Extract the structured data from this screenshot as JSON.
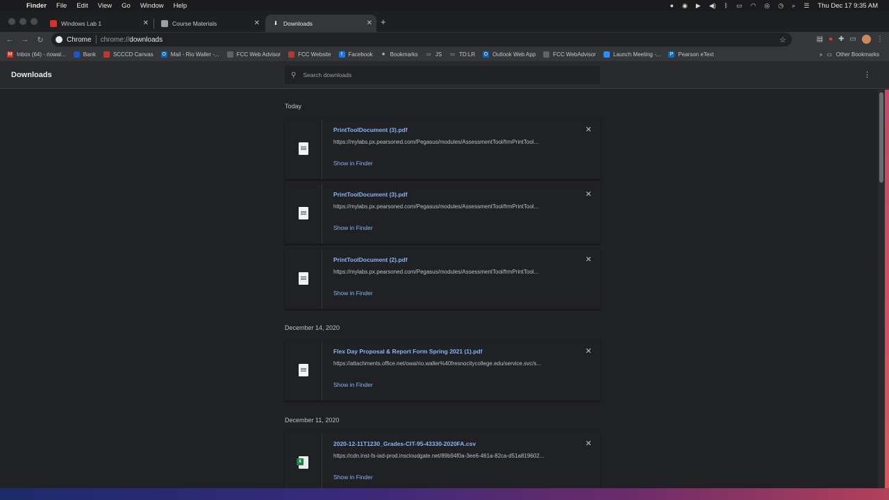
{
  "menubar": {
    "app": "Finder",
    "items": [
      "File",
      "Edit",
      "View",
      "Go",
      "Window",
      "Help"
    ],
    "clock": "Thu Dec 17  9:35 AM"
  },
  "tabs": [
    {
      "title": "Windows Lab 1",
      "icon_color": "#d93025"
    },
    {
      "title": "Course Materials",
      "icon_color": "#9aa0a6"
    },
    {
      "title": "Downloads",
      "icon_color": "#e8eaed"
    }
  ],
  "toolbar": {
    "site_label": "Chrome",
    "url_prefix": "chrome://",
    "url_host": "downloads"
  },
  "bookmarks": [
    {
      "label": "Inbox (64) - riowal...",
      "icon": "gmail-icon",
      "color": "#d93025",
      "glyph": "M"
    },
    {
      "label": "Bank",
      "icon": "bank-icon",
      "color": "#1a56c4",
      "glyph": ""
    },
    {
      "label": "SCCCD Canvas",
      "icon": "canvas-icon",
      "color": "#c0392b",
      "glyph": ""
    },
    {
      "label": "Mail - Rio Waller -...",
      "icon": "outlook-icon",
      "color": "#0a64c2",
      "glyph": "O"
    },
    {
      "label": "FCC Web Advisor",
      "icon": "globe-icon",
      "color": "#5f6368",
      "glyph": ""
    },
    {
      "label": "FCC Website",
      "icon": "fcc-icon",
      "color": "#b03a2e",
      "glyph": ""
    },
    {
      "label": "Facebook",
      "icon": "facebook-icon",
      "color": "#1877f2",
      "glyph": "f"
    },
    {
      "label": "Bookmarks",
      "icon": "star-icon",
      "color": "transparent",
      "glyph": "★"
    },
    {
      "label": "JS",
      "icon": "folder-icon",
      "color": "transparent",
      "glyph": "▭"
    },
    {
      "label": "TD:LR",
      "icon": "folder-icon",
      "color": "transparent",
      "glyph": "▭"
    },
    {
      "label": "Outlook Web App",
      "icon": "outlook-icon",
      "color": "#0a64c2",
      "glyph": "O"
    },
    {
      "label": "FCC WebAdvisor",
      "icon": "globe-icon",
      "color": "#5f6368",
      "glyph": ""
    },
    {
      "label": "Launch Meeting -...",
      "icon": "zoom-icon",
      "color": "#2d8cff",
      "glyph": ""
    },
    {
      "label": "Pearson eText",
      "icon": "pearson-icon",
      "color": "#0a6ebd",
      "glyph": "P"
    }
  ],
  "other_bookmarks": "Other Bookmarks",
  "page": {
    "title": "Downloads",
    "search_placeholder": "Search downloads"
  },
  "groups": [
    {
      "date": "Today",
      "items": [
        {
          "name": "PrintToolDocument (3).pdf",
          "url": "https://mylabs.px.pearsoned.com/Pegasus/modules/AssessmentTool/frmPrintTool...",
          "action": "Show in Finder",
          "type": "pdf"
        },
        {
          "name": "PrintToolDocument (3).pdf",
          "url": "https://mylabs.px.pearsoned.com/Pegasus/modules/AssessmentTool/frmPrintTool...",
          "action": "Show in Finder",
          "type": "pdf"
        },
        {
          "name": "PrintToolDocument (2).pdf",
          "url": "https://mylabs.px.pearsoned.com/Pegasus/modules/AssessmentTool/frmPrintTool...",
          "action": "Show in Finder",
          "type": "pdf"
        }
      ]
    },
    {
      "date": "December 14, 2020",
      "items": [
        {
          "name": "Flex Day Proposal & Report Form Spring 2021 (1).pdf",
          "url": "https://attachments.office.net/owa/rio.waller%40fresnocitycollege.edu/service.svc/s...",
          "action": "Show in Finder",
          "type": "pdf"
        }
      ]
    },
    {
      "date": "December 11, 2020",
      "items": [
        {
          "name": "2020-12-11T1230_Grades-CIT-95-43330-2020FA.csv",
          "url": "https://cdn.inst-fs-iad-prod.inscloudgate.net/89b94f0a-3ee6-461a-82ca-d51a819602...",
          "action": "Show in Finder",
          "type": "csv"
        }
      ]
    }
  ]
}
